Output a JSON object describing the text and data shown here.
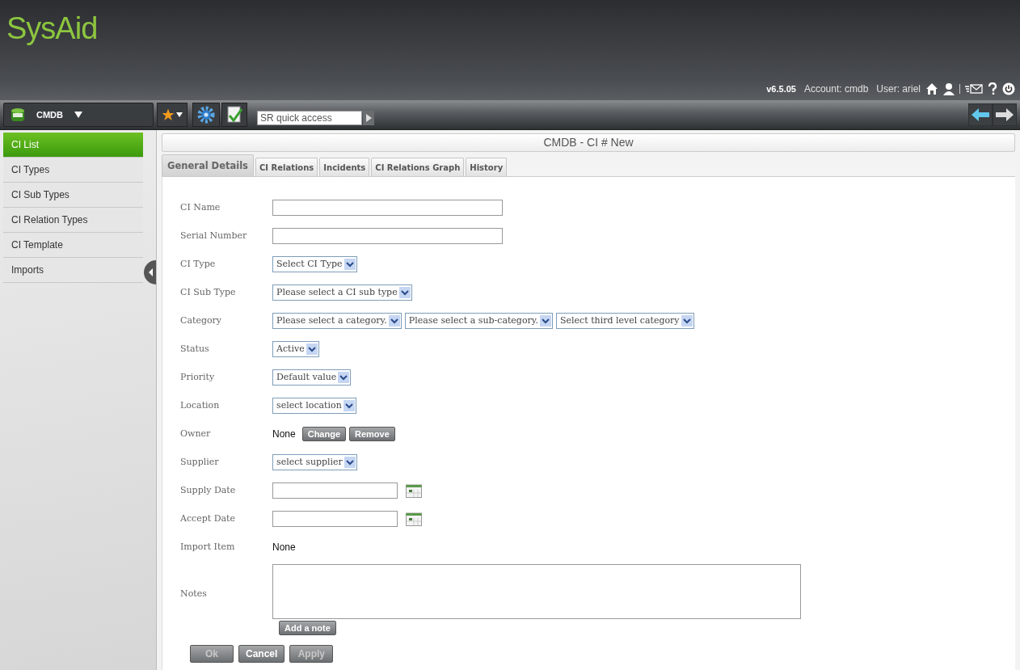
{
  "header": {
    "logo": "SysAid",
    "version": "v6.5.05",
    "account": "Account: cmdb",
    "user": "User: ariel"
  },
  "toolbar": {
    "module": "CMDB",
    "quick_access": {
      "placeholder": "SR quick access"
    }
  },
  "sidebar": {
    "items": [
      {
        "label": "CI List",
        "selected": true
      },
      {
        "label": "CI Types",
        "selected": false
      },
      {
        "label": "CI Sub Types",
        "selected": false
      },
      {
        "label": "CI Relation Types",
        "selected": false
      },
      {
        "label": "CI Template",
        "selected": false
      },
      {
        "label": "Imports",
        "selected": false
      }
    ]
  },
  "page_title": "CMDB - CI # New",
  "tabs": [
    {
      "label": "General Details",
      "selected": true
    },
    {
      "label": "CI Relations",
      "selected": false
    },
    {
      "label": "Incidents",
      "selected": false
    },
    {
      "label": "CI Relations Graph",
      "selected": false
    },
    {
      "label": "History",
      "selected": false
    }
  ],
  "form": {
    "rows": [
      {
        "label": "CI Name",
        "kind": "text"
      },
      {
        "label": "Serial Number",
        "kind": "text"
      },
      {
        "label": "CI Type",
        "kind": "select",
        "options": [
          "Select CI Type"
        ]
      },
      {
        "label": "CI Sub Type",
        "kind": "select",
        "options": [
          "Please select a CI sub type"
        ]
      },
      {
        "label": "Category",
        "kind": "select",
        "options": [
          "Please select a category.",
          "Please select a sub-category.",
          "Select third level category"
        ]
      },
      {
        "label": "Status",
        "kind": "select",
        "options": [
          "Active"
        ]
      },
      {
        "label": "Priority",
        "kind": "select",
        "options": [
          "Default value"
        ]
      },
      {
        "label": "Location",
        "kind": "select",
        "options": [
          "select location"
        ]
      },
      {
        "label": "Owner",
        "kind": "owner",
        "value": "None",
        "buttons": [
          "Change",
          "Remove"
        ]
      },
      {
        "label": "Supplier",
        "kind": "select",
        "options": [
          "select supplier"
        ]
      },
      {
        "label": "Supply Date",
        "kind": "date"
      },
      {
        "label": "Accept Date",
        "kind": "date"
      },
      {
        "label": "Import Item",
        "kind": "plain",
        "value": "None"
      },
      {
        "label": "Notes",
        "kind": "notes",
        "buttons": [
          "Add a note"
        ]
      }
    ],
    "actions": [
      {
        "label": "Ok",
        "disabled": true
      },
      {
        "label": "Cancel",
        "disabled": false
      },
      {
        "label": "Apply",
        "disabled": true
      }
    ]
  }
}
